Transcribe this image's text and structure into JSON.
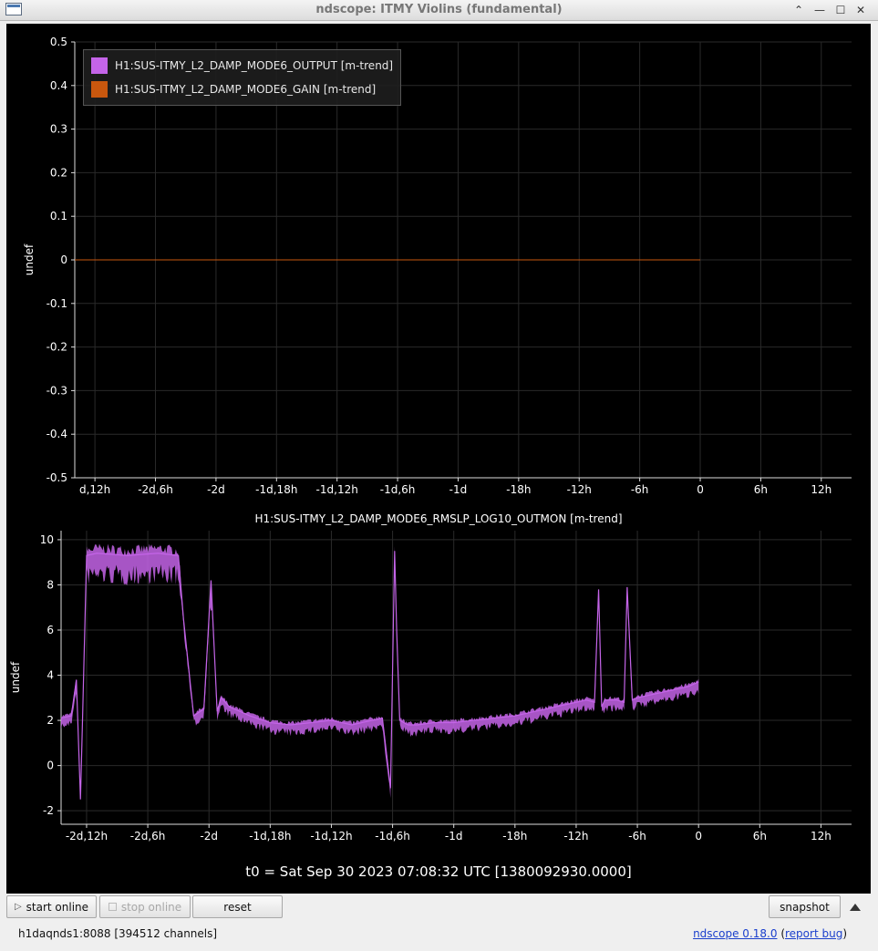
{
  "window": {
    "title": "ndscope: ITMY Violins (fundamental)"
  },
  "plot1": {
    "ylabel": "undef",
    "legend": [
      {
        "label": "H1:SUS-ITMY_L2_DAMP_MODE6_OUTPUT [m-trend]",
        "color": "#c464e8"
      },
      {
        "label": "H1:SUS-ITMY_L2_DAMP_MODE6_GAIN [m-trend]",
        "color": "#c8570e"
      }
    ],
    "yticks": [
      "0.5",
      "0.4",
      "0.3",
      "0.2",
      "0.1",
      "0",
      "-0.1",
      "-0.2",
      "-0.3",
      "-0.4",
      "-0.5"
    ],
    "xticks": [
      "d,12h",
      "-2d,6h",
      "-2d",
      "-1d,18h",
      "-1d,12h",
      "-1d,6h",
      "-1d",
      "-18h",
      "-12h",
      "-6h",
      "0",
      "6h",
      "12h"
    ]
  },
  "plot2": {
    "title": "H1:SUS-ITMY_L2_DAMP_MODE6_RMSLP_LOG10_OUTMON [m-trend]",
    "ylabel": "undef",
    "yticks": [
      "10",
      "8",
      "6",
      "4",
      "2",
      "0",
      "-2"
    ],
    "xticks": [
      "-2d,12h",
      "-2d,6h",
      "-2d",
      "-1d,18h",
      "-1d,12h",
      "-1d,6h",
      "-1d",
      "-18h",
      "-12h",
      "-6h",
      "0",
      "6h",
      "12h"
    ],
    "color": "#c464e8"
  },
  "t0_label": "t0 = Sat Sep 30 2023 07:08:32 UTC [1380092930.0000]",
  "buttons": {
    "start_online": "start online",
    "stop_online": "stop online",
    "reset": "reset",
    "snapshot": "snapshot"
  },
  "status": "h1daqnds1:8088  [394512 channels]",
  "version": {
    "name": "ndscope 0.18.0",
    "report": "report bug"
  },
  "chart_data": [
    {
      "type": "line",
      "title": "",
      "ylabel": "undef",
      "ylim": [
        -0.5,
        0.5
      ],
      "x_unit": "hours relative to t0",
      "xlim": [
        -62,
        15
      ],
      "x_ticks_hours": [
        -60,
        -54,
        -48,
        -42,
        -36,
        -30,
        -24,
        -18,
        -12,
        -6,
        0,
        6,
        12
      ],
      "series": [
        {
          "name": "H1:SUS-ITMY_L2_DAMP_MODE6_OUTPUT [m-trend]",
          "x": [
            -62,
            0
          ],
          "y": [
            0,
            0
          ]
        },
        {
          "name": "H1:SUS-ITMY_L2_DAMP_MODE6_GAIN [m-trend]",
          "x": [
            -62,
            0
          ],
          "y": [
            0,
            0
          ]
        }
      ]
    },
    {
      "type": "line",
      "title": "H1:SUS-ITMY_L2_DAMP_MODE6_RMSLP_LOG10_OUTMON [m-trend]",
      "ylabel": "undef",
      "ylim": [
        -2.6,
        10.4
      ],
      "x_unit": "hours relative to t0",
      "xlim": [
        -62.5,
        15
      ],
      "x_ticks_hours": [
        -60,
        -54,
        -48,
        -42,
        -36,
        -30,
        -24,
        -18,
        -12,
        -6,
        0,
        6,
        12
      ],
      "series": [
        {
          "name": "H1:SUS-ITMY_L2_DAMP_MODE6_RMSLP_LOG10_OUTMON [m-trend]",
          "x": [
            -62.5,
            -61.5,
            -61.0,
            -60.6,
            -60.4,
            -60.0,
            -59.0,
            -56.0,
            -53.0,
            -51.0,
            -50.5,
            -49.5,
            -48.5,
            -47.8,
            -47.2,
            -46.8,
            -46.0,
            -44.0,
            -42.0,
            -40.0,
            -38.0,
            -36.0,
            -34.0,
            -32.0,
            -31.0,
            -30.2,
            -29.8,
            -29.6,
            -29.3,
            -28.5,
            -27.5,
            -26.0,
            -24.0,
            -22.0,
            -20.0,
            -18.0,
            -16.0,
            -14.0,
            -12.0,
            -11.0,
            -10.2,
            -9.8,
            -9.5,
            -9.2,
            -8.0,
            -7.3,
            -7.0,
            -6.5,
            -6.0,
            -5.0,
            -3.0,
            -1.0,
            0.0
          ],
          "y": [
            2.1,
            2.2,
            3.8,
            -1.5,
            2.0,
            9.3,
            9.4,
            9.3,
            9.4,
            9.3,
            6.5,
            2.2,
            2.5,
            8.2,
            2.4,
            3.0,
            2.6,
            2.2,
            1.9,
            1.8,
            1.9,
            2.0,
            1.8,
            2.0,
            2.1,
            -1.0,
            9.5,
            6.0,
            2.0,
            1.8,
            1.8,
            1.9,
            1.9,
            2.0,
            2.1,
            2.2,
            2.4,
            2.6,
            2.8,
            2.9,
            2.8,
            7.8,
            2.6,
            2.9,
            2.9,
            2.8,
            7.9,
            2.9,
            3.0,
            3.1,
            3.3,
            3.5,
            3.7
          ]
        }
      ]
    }
  ]
}
